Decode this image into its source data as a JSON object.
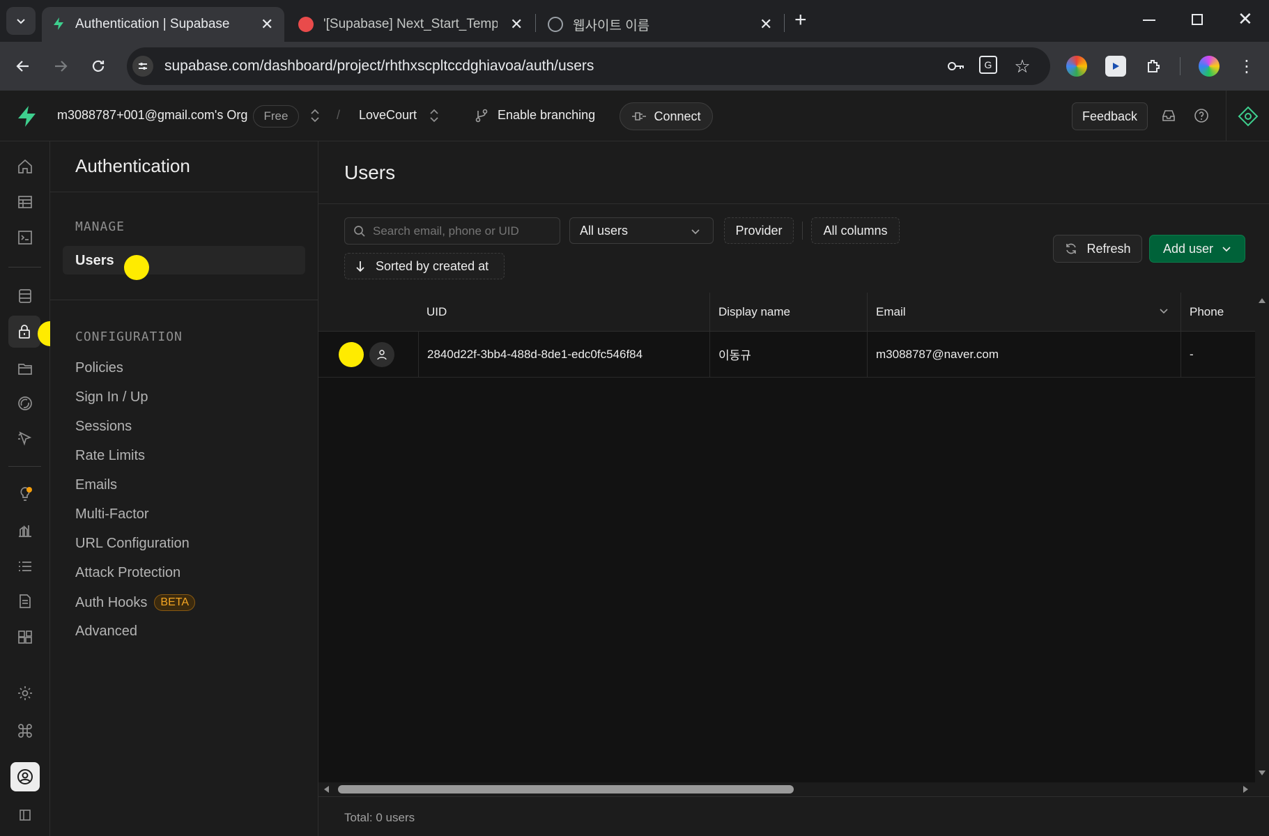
{
  "browser": {
    "tabs": [
      {
        "title": "Authentication | Supabase"
      },
      {
        "title": "'[Supabase] Next_Start_Templa"
      },
      {
        "title": "웹사이트 이름"
      }
    ],
    "url": "supabase.com/dashboard/project/rhthxscpltccdghiavoa/auth/users"
  },
  "header": {
    "org": "m3088787+001@gmail.com's Org",
    "plan": "Free",
    "separator": "/",
    "project": "LoveCourt",
    "branching": "Enable branching",
    "connect": "Connect",
    "feedback": "Feedback"
  },
  "sidebar": {
    "title": "Authentication",
    "manage_heading": "MANAGE",
    "manage_items": [
      {
        "label": "Users"
      }
    ],
    "config_heading": "CONFIGURATION",
    "config_items": [
      {
        "label": "Policies"
      },
      {
        "label": "Sign In / Up"
      },
      {
        "label": "Sessions"
      },
      {
        "label": "Rate Limits"
      },
      {
        "label": "Emails"
      },
      {
        "label": "Multi-Factor"
      },
      {
        "label": "URL Configuration"
      },
      {
        "label": "Attack Protection"
      },
      {
        "label": "Auth Hooks",
        "badge": "BETA"
      },
      {
        "label": "Advanced"
      }
    ]
  },
  "main": {
    "title": "Users",
    "search_placeholder": "Search email, phone or UID",
    "filter_users": "All users",
    "filter_provider": "Provider",
    "filter_columns": "All columns",
    "sort_label": "Sorted by created at",
    "refresh": "Refresh",
    "add_user": "Add user",
    "table": {
      "columns": [
        "UID",
        "Display name",
        "Email",
        "Phone"
      ],
      "rows": [
        {
          "uid": "2840d22f-3bb4-488d-8de1-edc0fc546f84",
          "display_name": "이동규",
          "email": "m3088787@naver.com",
          "phone": "-"
        }
      ]
    },
    "footer": "Total: 0 users"
  },
  "colors": {
    "brand": "#3ecf8e",
    "add_user_bg": "#006239",
    "marker": "#ffeb00",
    "beta": "#f5a623"
  }
}
